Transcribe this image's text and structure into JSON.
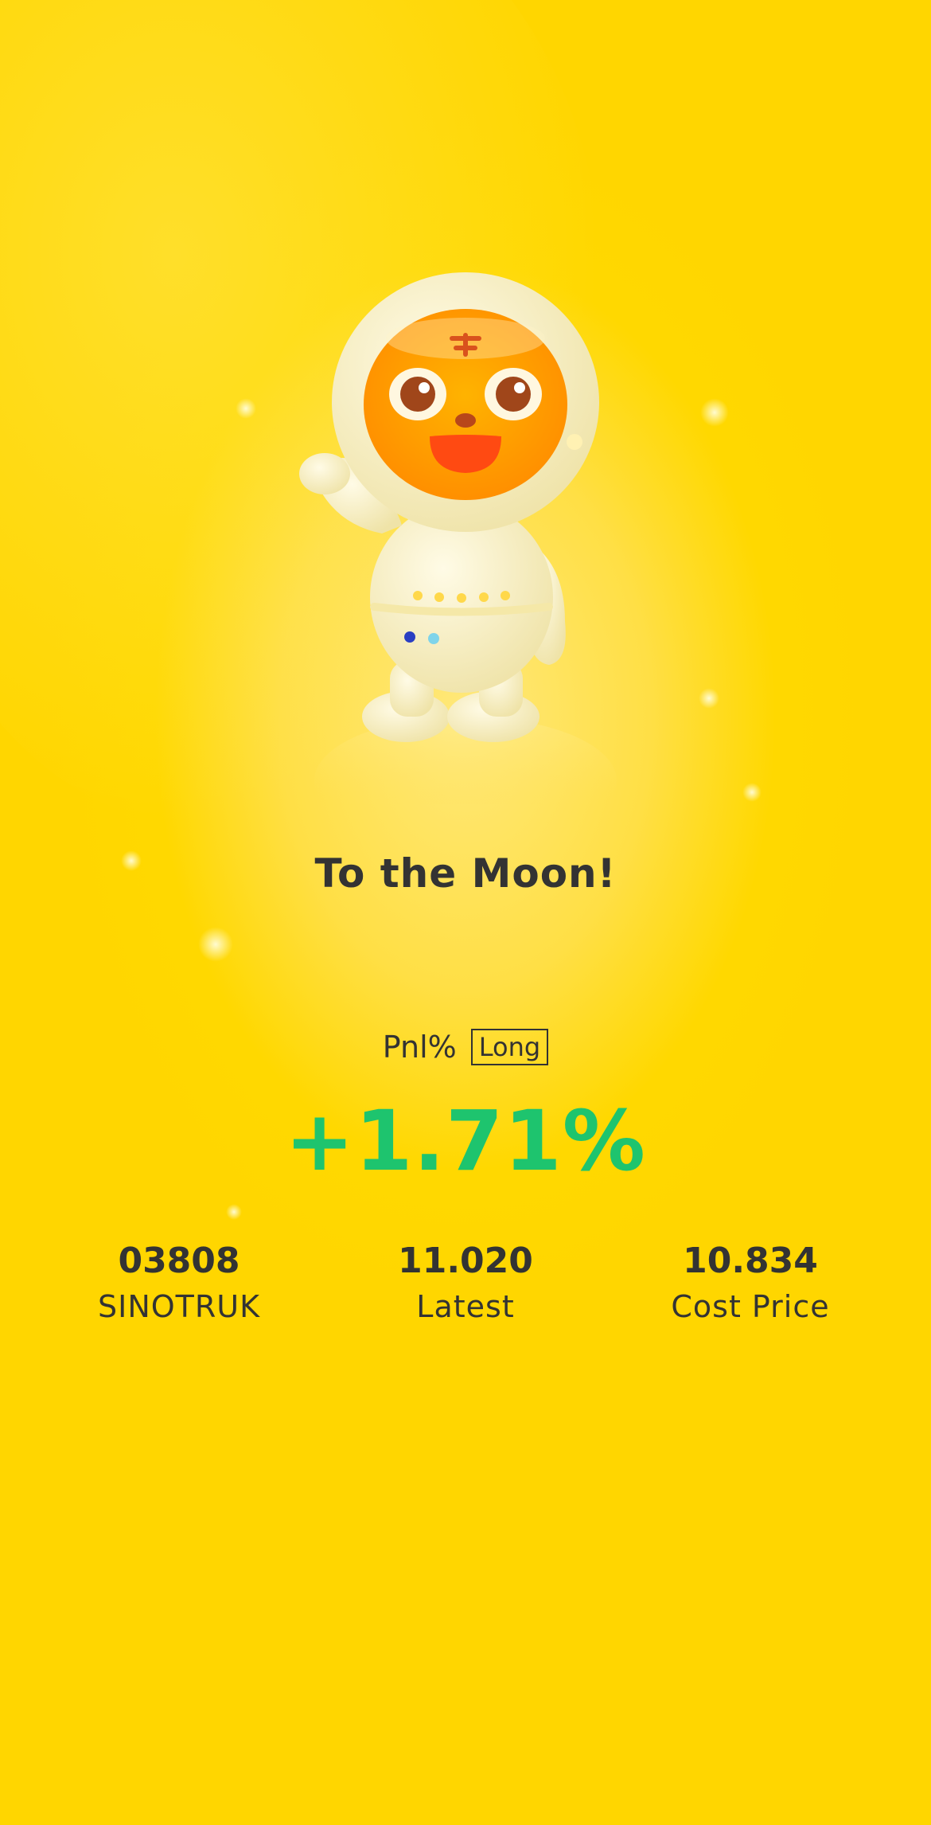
{
  "hero": {
    "headline": "To the Moon!",
    "illustration": "tiger-astronaut-mascot"
  },
  "pnl": {
    "label": "Pnl%",
    "side": "Long",
    "value": "+1.71%",
    "value_color": "#1ec46e"
  },
  "stats": [
    {
      "value": "03808",
      "label": "SINOTRUK"
    },
    {
      "value": "11.020",
      "label": "Latest"
    },
    {
      "value": "10.834",
      "label": "Cost Price"
    }
  ],
  "colors": {
    "background": "#ffd800",
    "text": "#333333",
    "gain": "#1ec46e"
  }
}
